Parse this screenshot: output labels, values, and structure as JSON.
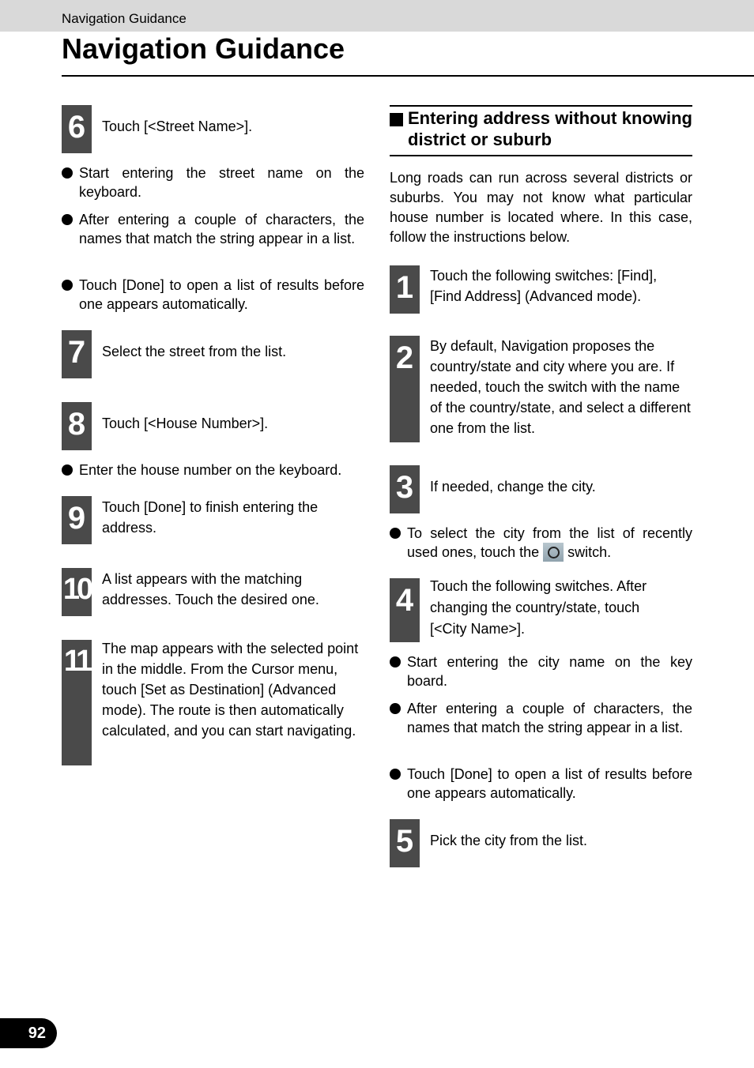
{
  "header": {
    "running_title": "Navigation Guidance",
    "page_title": "Navigation Guidance"
  },
  "left_column": {
    "step6": {
      "number": "6",
      "text": "Touch [<Street Name>].",
      "bullets": [
        "Start entering the street name on the keyboard.",
        "After entering a couple of characters, the names that match the string appear in a list.",
        "Touch [Done] to open a list of results before one appears automatically."
      ]
    },
    "step7": {
      "number": "7",
      "text": "Select the street from the list."
    },
    "step8": {
      "number": "8",
      "text": "Touch [<House Number>].",
      "bullets": [
        "Enter the house number on the keyboard."
      ]
    },
    "step9": {
      "number": "9",
      "text": "Touch [Done] to finish entering the address."
    },
    "step10": {
      "number": "10",
      "text": "A list appears with the matching addresses. Touch the desired one."
    },
    "step11": {
      "number": "11",
      "text": "The map appears with the selected point in the middle. From the Cursor menu, touch [Set as Destination] (Advanced mode). The route is then automatically calculated, and you can start navigating."
    }
  },
  "right_column": {
    "section_heading": "Entering address without knowing district or suburb",
    "intro": "Long roads can run across several districts or suburbs. You may not know what particular house number is located where. In this case, follow the instructions below.",
    "step1": {
      "number": "1",
      "text": "Touch the following switches: [Find], [Find Address] (Advanced mode)."
    },
    "step2": {
      "number": "2",
      "text": "By default, Navigation proposes the country/state and city where you are. If needed, touch the switch with the name of the country/state, and select a different one from the list."
    },
    "step3": {
      "number": "3",
      "text": "If needed, change the city.",
      "bullet_before_icon": "To select the city from the list of recently used ones, touch the",
      "bullet_after_icon": "switch.",
      "icon": "recent-history-icon"
    },
    "step4": {
      "number": "4",
      "text": "Touch the following switches. After changing the country/state, touch [<City Name>].",
      "bullets": [
        "Start entering the city name on the key board.",
        "After entering a couple of characters, the names that match the string appear in a list.",
        "Touch [Done] to open a list of results before one appears automatically."
      ]
    },
    "step5": {
      "number": "5",
      "text": "Pick the city from the list."
    }
  },
  "footer": {
    "page_number": "92"
  }
}
